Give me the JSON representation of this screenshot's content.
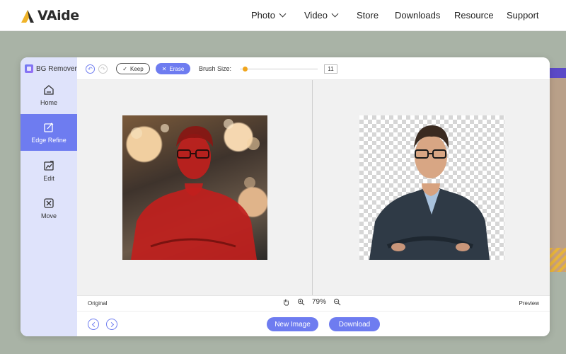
{
  "site": {
    "logo_text": "VAide",
    "nav": [
      {
        "label": "Photo"
      },
      {
        "label": "Video"
      },
      {
        "label": "Store"
      },
      {
        "label": "Downloads"
      },
      {
        "label": "Resource"
      },
      {
        "label": "Support"
      }
    ]
  },
  "app": {
    "title": "BG Remover",
    "sidebar": [
      {
        "label": "Home",
        "icon": "home-icon"
      },
      {
        "label": "Edge Refine",
        "icon": "edge-refine-icon",
        "active": true
      },
      {
        "label": "Edit",
        "icon": "edit-icon"
      },
      {
        "label": "Move",
        "icon": "move-icon"
      }
    ],
    "toolbar": {
      "keep_label": "Keep",
      "erase_label": "Erase",
      "brush_label": "Brush Size:",
      "brush_value": "11"
    },
    "status": {
      "original_label": "Original",
      "preview_label": "Preview",
      "zoom": "79%"
    },
    "footer": {
      "new_image_label": "New Image",
      "download_label": "Download"
    }
  },
  "colors": {
    "accent": "#6e7cf0",
    "sidebar_bg": "#dfe3fb",
    "page_bg": "#a9b3a6",
    "slider_thumb": "#f0a51c",
    "erase_mask": "#c0201d"
  }
}
